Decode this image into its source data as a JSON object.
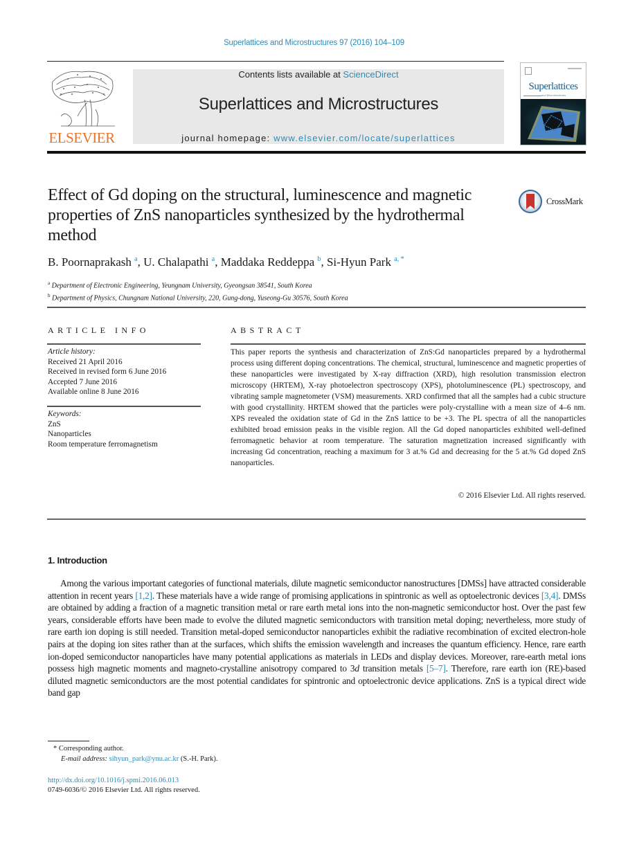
{
  "header": {
    "citation": "Superlattices and Microstructures 97 (2016) 104–109",
    "contents_prefix": "Contents lists available at ",
    "contents_link": "ScienceDirect",
    "journal_title": "Superlattices and Microstructures",
    "homepage_prefix": "journal homepage: ",
    "homepage_link": "www.elsevier.com/locate/superlattices",
    "publisher_logo_text": "ELSEVIER",
    "cover_title": "Superlattices",
    "cover_subtitle": "and Microstructures"
  },
  "article": {
    "title": "Effect of Gd doping on the structural, luminescence and magnetic properties of ZnS nanoparticles synthesized by the hydrothermal method",
    "crossmark_label": "CrossMark",
    "authors": [
      {
        "name": "B. Poornaprakash",
        "sup": "a"
      },
      {
        "name": "U. Chalapathi",
        "sup": "a"
      },
      {
        "name": "Maddaka Reddeppa",
        "sup": "b"
      },
      {
        "name": "Si-Hyun Park",
        "sup": "a, *"
      }
    ],
    "affiliations": [
      {
        "mark": "a",
        "text": "Department of Electronic Engineering, Yeungnam University, Gyeongsan 38541, South Korea"
      },
      {
        "mark": "b",
        "text": "Department of Physics, Chungnam National University, 220, Gung-dong, Yuseong-Gu 30576, South Korea"
      }
    ]
  },
  "article_info": {
    "heading": "ARTICLE INFO",
    "history_label": "Article history:",
    "history": [
      "Received 21 April 2016",
      "Received in revised form 6 June 2016",
      "Accepted 7 June 2016",
      "Available online 8 June 2016"
    ],
    "keywords_label": "Keywords:",
    "keywords": [
      "ZnS",
      "Nanoparticles",
      "Room temperature ferromagnetism"
    ]
  },
  "abstract": {
    "heading": "ABSTRACT",
    "text": "This paper reports the synthesis and characterization of ZnS:Gd nanoparticles prepared by a hydrothermal process using different doping concentrations. The chemical, structural, luminescence and magnetic properties of these nanoparticles were investigated by X-ray diffraction (XRD), high resolution transmission electron microscopy (HRTEM), X-ray photoelectron spectroscopy (XPS), photoluminescence (PL) spectroscopy, and vibrating sample magnetometer (VSM) measurements. XRD confirmed that all the samples had a cubic structure with good crystallinity. HRTEM showed that the particles were poly-crystalline with a mean size of 4–6 nm. XPS revealed the oxidation state of Gd in the ZnS lattice to be +3. The PL spectra of all the nanoparticles exhibited broad emission peaks in the visible region. All the Gd doped nanoparticles exhibited well-defined ferromagnetic behavior at room temperature. The saturation magnetization increased significantly with increasing Gd concentration, reaching a maximum for 3 at.% Gd and decreasing for the 5 at.% Gd doped ZnS nanoparticles.",
    "copyright": "© 2016 Elsevier Ltd. All rights reserved."
  },
  "introduction": {
    "heading": "1.  Introduction",
    "segments": [
      {
        "t": "Among the various important categories of functional materials, dilute magnetic semiconductor nanostructures [DMSs] have attracted considerable attention in recent years "
      },
      {
        "ref": "[1,2]"
      },
      {
        "t": ". These materials have a wide range of promising applications in spintronic as well as optoelectronic devices "
      },
      {
        "ref": "[3,4]"
      },
      {
        "t": ". DMSs are obtained by adding a fraction of a magnetic transition metal or rare earth metal ions into the non-magnetic semiconductor host. Over the past few years, considerable efforts have been made to evolve the diluted magnetic semiconductors with transition metal doping; nevertheless, more study of rare earth ion doping is still needed. Transition metal-doped semiconductor nanoparticles exhibit the radiative recombination of excited electron-hole pairs at the doping ion sites rather than at the surfaces, which shifts the emission wavelength and increases the quantum efficiency. Hence, rare earth ion-doped semiconductor nanoparticles have many potential applications as materials in LEDs and display devices. Moreover, rare-earth metal ions possess high magnetic moments and magneto-crystalline anisotropy compared to 3"
      },
      {
        "i": "d"
      },
      {
        "t": " transition metals "
      },
      {
        "ref": "[5–7]"
      },
      {
        "t": ". Therefore, rare earth ion (RE)-based diluted magnetic semiconductors are the most potential candidates for spintronic and optoelectronic device applications. ZnS is a typical direct wide band gap"
      }
    ]
  },
  "footnotes": {
    "corresponding": "* Corresponding author.",
    "email_label": "E-mail address: ",
    "email": "sihyun_park@ynu.ac.kr",
    "email_suffix": " (S.-H. Park).",
    "doi": "http://dx.doi.org/10.1016/j.spmi.2016.06.013",
    "issn_copyright": "0749-6036/© 2016 Elsevier Ltd. All rights reserved."
  }
}
